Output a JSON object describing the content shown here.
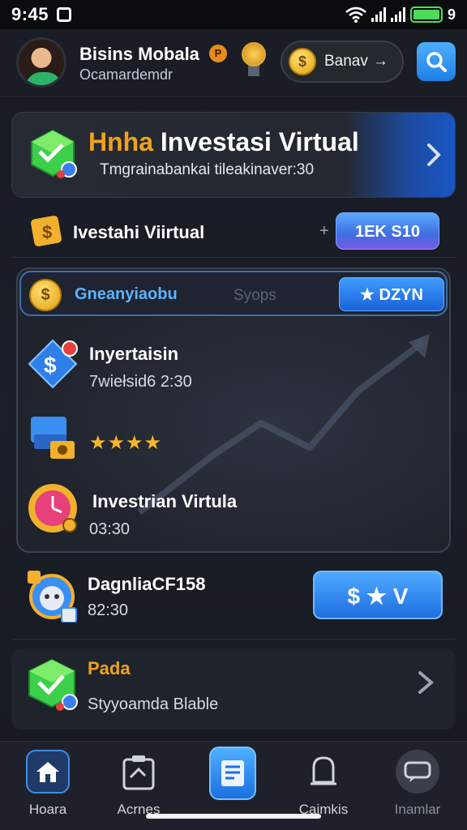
{
  "status_bar": {
    "time": "9:45",
    "battery": "9"
  },
  "header": {
    "brand_name": "Bisins Mobala",
    "brand_badge": "P",
    "brand_sub": "Ocamardemdr",
    "coin_symbol": "$",
    "coin_label": "Banav",
    "coin_arrow": "→"
  },
  "banner": {
    "title_accent": "Hnha",
    "title": "Investasi Virtual",
    "subtitle": "Tmgrainabankai tileakinaver:30"
  },
  "row2": {
    "label": "Ivestahi Viirtual",
    "plus": "+",
    "button": "1EK S10"
  },
  "panel": {
    "coin_symbol": "$",
    "tab_active": "Gneanyiaobu",
    "tab_inactive": "Syops",
    "button": "★ DZYN",
    "items": [
      {
        "title": "Inyertaisin",
        "sub": "7wiełsid6 2:30"
      },
      {
        "stars": "★★★★"
      },
      {
        "title": "Investrian Virtula",
        "sub": "03:30"
      }
    ]
  },
  "lower_items": [
    {
      "title": "DagnliaCF158",
      "sub": "82:30",
      "button": "$ ★ V"
    },
    {
      "title": "Pada",
      "sub": "Styyoamda Blable"
    }
  ],
  "bottom_nav": [
    {
      "label": "Hoara"
    },
    {
      "label": "Acrnes"
    },
    {
      "label": ""
    },
    {
      "label": "Caimkis"
    },
    {
      "label": "Inamlar"
    }
  ],
  "colors": {
    "accent_blue": "#2f86f0",
    "accent_orange": "#f0a21c",
    "bg": "#171a22"
  }
}
